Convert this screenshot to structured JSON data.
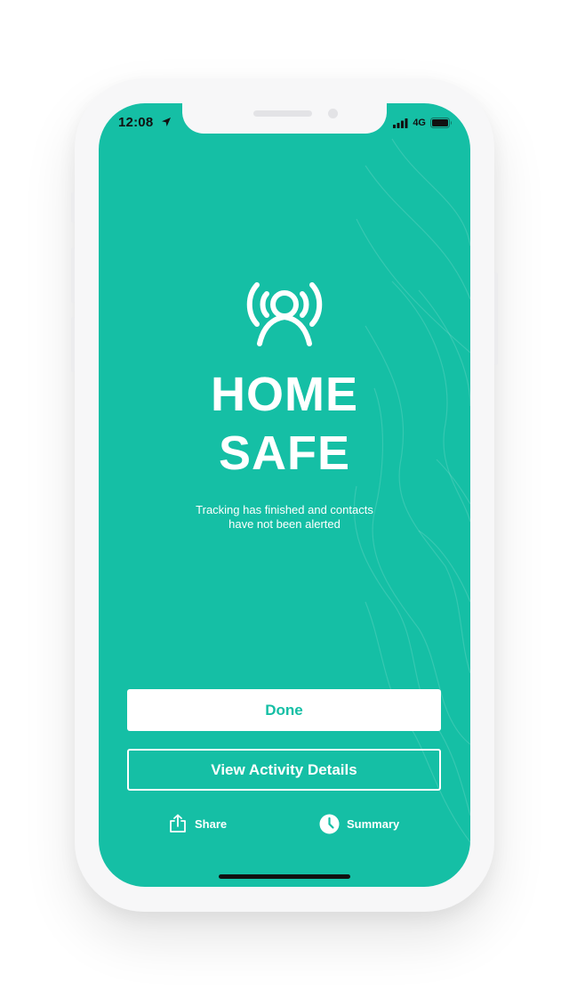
{
  "status_bar": {
    "time": "12:08",
    "network": "4G"
  },
  "main": {
    "title_line1": "HOME",
    "title_line2": "SAFE",
    "subtitle_line1": "Tracking has finished and contacts",
    "subtitle_line2": "have not been alerted"
  },
  "actions": {
    "done_label": "Done",
    "details_label": "View Activity Details",
    "share_label": "Share",
    "summary_label": "Summary"
  },
  "icons": {
    "logo": "person-signal-icon",
    "share": "share-icon",
    "summary": "clock-icon",
    "location": "location-arrow-icon",
    "signal": "cellular-signal-icon",
    "battery": "battery-icon"
  },
  "colors": {
    "accent": "#15bfa5",
    "text_on_accent": "#ffffff"
  }
}
